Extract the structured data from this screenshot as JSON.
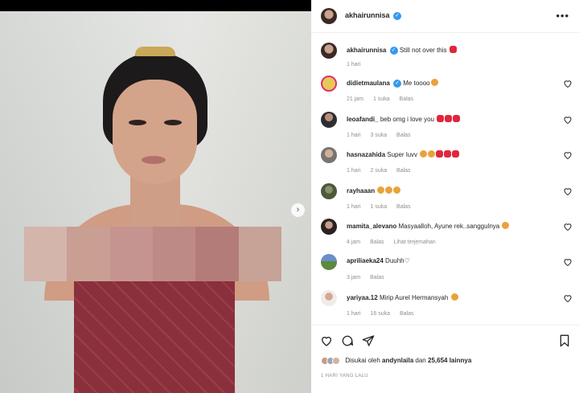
{
  "post": {
    "author": "akhairunnisa",
    "caption_text": "Still not over this",
    "caption_age": "1 hari",
    "likes_prefix": "Disukai oleh",
    "likes_user": "andynlaila",
    "likes_middle": "dan",
    "likes_count": "25,654",
    "likes_suffix": "lainnya",
    "timestamp": "1 HARI YANG LALU"
  },
  "comments": [
    {
      "user": "didietmaulana",
      "verified": true,
      "text": "Me toooo",
      "emojis": [
        "smile"
      ],
      "age": "21 jam",
      "likes": "1 suka",
      "reply": "Balas",
      "extra": ""
    },
    {
      "user": "leoafandi_",
      "verified": false,
      "text": "beb omg i love you",
      "emojis": [
        "heart",
        "heart",
        "heart"
      ],
      "age": "1 hari",
      "likes": "3 suka",
      "reply": "Balas",
      "extra": ""
    },
    {
      "user": "hasnazahida",
      "verified": false,
      "text": "Super luvv",
      "emojis": [
        "smile",
        "smile",
        "heart",
        "heart",
        "heart"
      ],
      "age": "1 hari",
      "likes": "2 suka",
      "reply": "Balas",
      "extra": ""
    },
    {
      "user": "rayhaaan",
      "verified": false,
      "text": "",
      "emojis": [
        "smile",
        "smile",
        "smile"
      ],
      "age": "1 hari",
      "likes": "1 suka",
      "reply": "Balas",
      "extra": ""
    },
    {
      "user": "mamita_alevano",
      "verified": false,
      "text": "Masyaalloh, Ayune rek..sanggulnya",
      "emojis": [
        "smile"
      ],
      "age": "4 jam",
      "likes": "",
      "reply": "Balas",
      "extra": "Lihat terjemahan"
    },
    {
      "user": "apriliaeka24",
      "verified": false,
      "text": "Duuhh♡",
      "emojis": [],
      "age": "3 jam",
      "likes": "",
      "reply": "Balas",
      "extra": ""
    },
    {
      "user": "yariyaa.12",
      "verified": false,
      "text": "Mirip Aurel Hermansyah",
      "emojis": [
        "smile"
      ],
      "age": "1 hari",
      "likes": "16 suka",
      "reply": "Balas",
      "extra": ""
    }
  ],
  "icons": {
    "like": "heart-outline-icon",
    "comment": "speech-bubble-icon",
    "share": "paper-plane-icon",
    "save": "bookmark-icon",
    "more": "ellipsis-icon",
    "next": "chevron-right-icon"
  },
  "colors": {
    "verified": "#3897f0",
    "text": "#262626",
    "meta": "#8e8e8e",
    "heart_emoji": "#e0263a"
  }
}
